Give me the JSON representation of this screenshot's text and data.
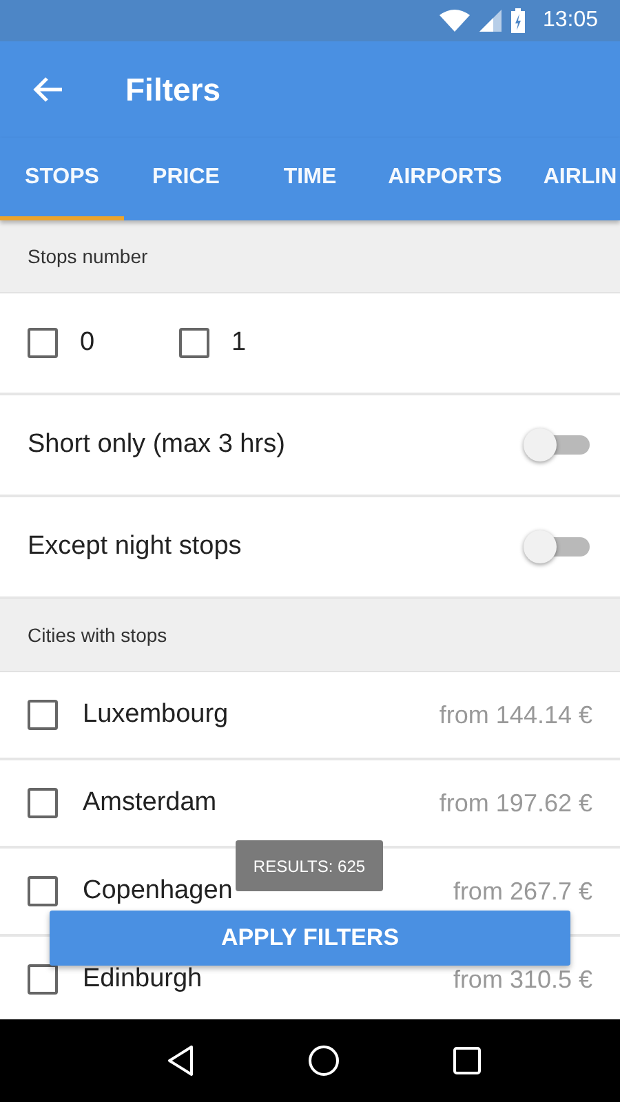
{
  "status_bar": {
    "time": "13:05"
  },
  "app_bar": {
    "title": "Filters"
  },
  "tabs": [
    {
      "label": "STOPS",
      "selected": true
    },
    {
      "label": "PRICE",
      "selected": false
    },
    {
      "label": "TIME",
      "selected": false
    },
    {
      "label": "AIRPORTS",
      "selected": false
    },
    {
      "label": "AIRLIN",
      "selected": false
    }
  ],
  "stops_section": {
    "header": "Stops number",
    "options": [
      {
        "label": "0",
        "checked": false
      },
      {
        "label": "1",
        "checked": false
      }
    ]
  },
  "toggles": [
    {
      "label": "Short only (max 3 hrs)",
      "on": false
    },
    {
      "label": "Except night stops",
      "on": false
    }
  ],
  "cities_section": {
    "header": "Cities with stops",
    "cities": [
      {
        "name": "Luxembourg",
        "price": "from 144.14 €",
        "checked": false
      },
      {
        "name": "Amsterdam",
        "price": "from 197.62 €",
        "checked": false
      },
      {
        "name": "Copenhagen",
        "price": "from 267.7 €",
        "checked": false
      },
      {
        "name": "Edinburgh",
        "price": "from 310.5 €",
        "checked": false
      }
    ]
  },
  "toast": "RESULTS: 625",
  "apply_button": "APPLY FILTERS"
}
